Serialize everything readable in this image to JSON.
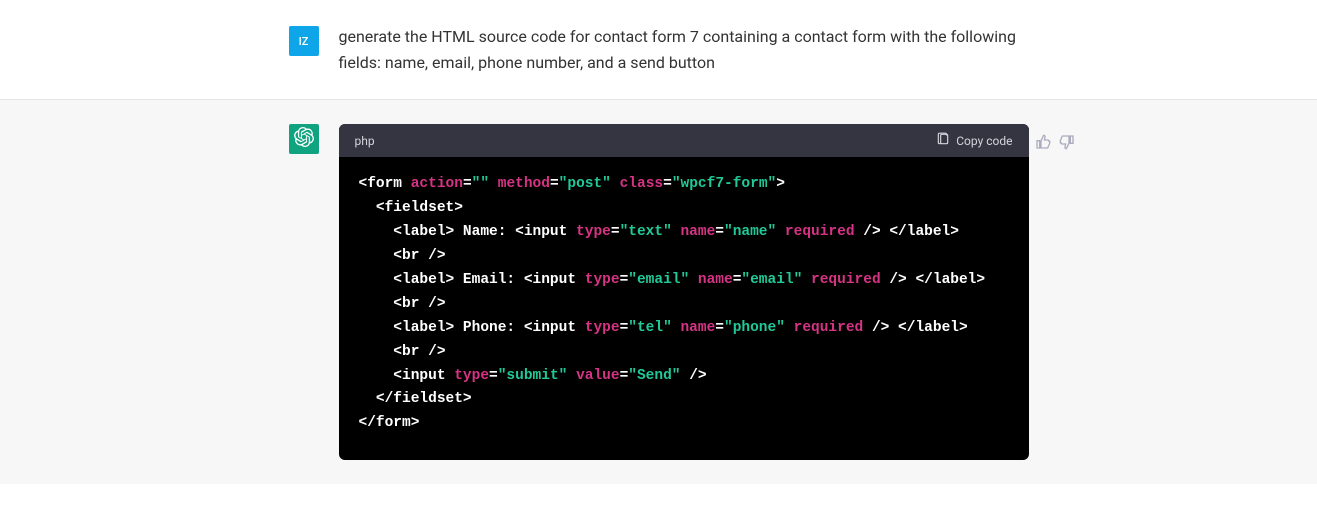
{
  "user": {
    "avatar_initials": "IZ",
    "message": "generate the HTML source code for contact form 7 containing a contact form with the following fields: name, email, phone number, and a send button"
  },
  "assistant": {
    "code_lang": "php",
    "copy_label": "Copy code",
    "code_tokens": [
      [
        {
          "t": "tag",
          "v": "<form "
        },
        {
          "t": "attr",
          "v": "action"
        },
        {
          "t": "eq",
          "v": "="
        },
        {
          "t": "str",
          "v": "\"\""
        },
        {
          "t": "tag",
          "v": " "
        },
        {
          "t": "attr",
          "v": "method"
        },
        {
          "t": "eq",
          "v": "="
        },
        {
          "t": "str",
          "v": "\"post\""
        },
        {
          "t": "tag",
          "v": " "
        },
        {
          "t": "attr",
          "v": "class"
        },
        {
          "t": "eq",
          "v": "="
        },
        {
          "t": "str",
          "v": "\"wpcf7-form\""
        },
        {
          "t": "tag",
          "v": ">"
        }
      ],
      [
        {
          "t": "tag",
          "v": "  <fieldset>"
        }
      ],
      [
        {
          "t": "tag",
          "v": "    <label> Name: <input "
        },
        {
          "t": "attr",
          "v": "type"
        },
        {
          "t": "eq",
          "v": "="
        },
        {
          "t": "str",
          "v": "\"text\""
        },
        {
          "t": "tag",
          "v": " "
        },
        {
          "t": "attr",
          "v": "name"
        },
        {
          "t": "eq",
          "v": "="
        },
        {
          "t": "str",
          "v": "\"name\""
        },
        {
          "t": "tag",
          "v": " "
        },
        {
          "t": "kw",
          "v": "required"
        },
        {
          "t": "tag",
          "v": " /> </label>"
        }
      ],
      [
        {
          "t": "tag",
          "v": "    <br />"
        }
      ],
      [
        {
          "t": "tag",
          "v": "    <label> Email: <input "
        },
        {
          "t": "attr",
          "v": "type"
        },
        {
          "t": "eq",
          "v": "="
        },
        {
          "t": "str",
          "v": "\"email\""
        },
        {
          "t": "tag",
          "v": " "
        },
        {
          "t": "attr",
          "v": "name"
        },
        {
          "t": "eq",
          "v": "="
        },
        {
          "t": "str",
          "v": "\"email\""
        },
        {
          "t": "tag",
          "v": " "
        },
        {
          "t": "kw",
          "v": "required"
        },
        {
          "t": "tag",
          "v": " /> </label>"
        }
      ],
      [
        {
          "t": "tag",
          "v": "    <br />"
        }
      ],
      [
        {
          "t": "tag",
          "v": "    <label> Phone: <input "
        },
        {
          "t": "attr",
          "v": "type"
        },
        {
          "t": "eq",
          "v": "="
        },
        {
          "t": "str",
          "v": "\"tel\""
        },
        {
          "t": "tag",
          "v": " "
        },
        {
          "t": "attr",
          "v": "name"
        },
        {
          "t": "eq",
          "v": "="
        },
        {
          "t": "str",
          "v": "\"phone\""
        },
        {
          "t": "tag",
          "v": " "
        },
        {
          "t": "kw",
          "v": "required"
        },
        {
          "t": "tag",
          "v": " /> </label>"
        }
      ],
      [
        {
          "t": "tag",
          "v": "    <br />"
        }
      ],
      [
        {
          "t": "tag",
          "v": "    <input "
        },
        {
          "t": "attr",
          "v": "type"
        },
        {
          "t": "eq",
          "v": "="
        },
        {
          "t": "str",
          "v": "\"submit\""
        },
        {
          "t": "tag",
          "v": " "
        },
        {
          "t": "attr",
          "v": "value"
        },
        {
          "t": "eq",
          "v": "="
        },
        {
          "t": "str",
          "v": "\"Send\""
        },
        {
          "t": "tag",
          "v": " />"
        }
      ],
      [
        {
          "t": "tag",
          "v": "  </fieldset>"
        }
      ],
      [
        {
          "t": "tag",
          "v": "</form>"
        }
      ]
    ]
  }
}
